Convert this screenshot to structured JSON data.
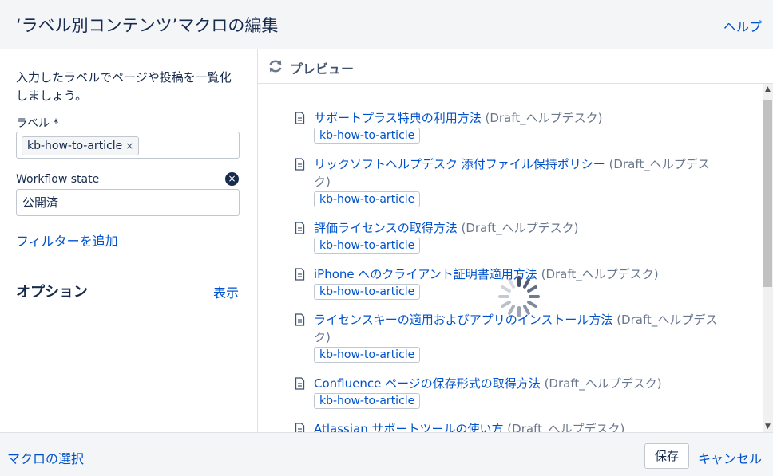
{
  "header": {
    "title": "‘ラベル別コンテンツ’マクロの編集",
    "help": "ヘルプ"
  },
  "left": {
    "description": "入力したラベルでページや投稿を一覧化しましょう。",
    "label_field": {
      "label": "ラベル *",
      "chip": "kb-how-to-article",
      "chip_remove": "×"
    },
    "workflow": {
      "label": "Workflow state",
      "clear": "×",
      "value": "公開済"
    },
    "add_filter": "フィルターを追加",
    "options": {
      "heading": "オプション",
      "show": "表示"
    }
  },
  "preview": {
    "title": "プレビュー",
    "items": [
      {
        "title": "サポートプラス特典の利用方法",
        "space": "(Draft_ヘルプデスク)",
        "tag": "kb-how-to-article"
      },
      {
        "title": "リックソフトヘルプデスク 添付ファイル保持ポリシー",
        "space": "(Draft_ヘルプデスク)",
        "tag": "kb-how-to-article"
      },
      {
        "title": "評価ライセンスの取得方法",
        "space": "(Draft_ヘルプデスク)",
        "tag": "kb-how-to-article"
      },
      {
        "title": "iPhone へのクライアント証明書適用方法",
        "space": "(Draft_ヘルプデスク)",
        "tag": "kb-how-to-article"
      },
      {
        "title": "ライセンスキーの適用およびアプリのインストール方法",
        "space": "(Draft_ヘルプデスク)",
        "tag": "kb-how-to-article"
      },
      {
        "title": "Confluence ページの保存形式の取得方法",
        "space": "(Draft_ヘルプデスク)",
        "tag": "kb-how-to-article"
      },
      {
        "title": "Atlassian サポートツールの使い方",
        "space": "(Draft_ヘルプデスク)",
        "tag": ""
      }
    ]
  },
  "footer": {
    "select_macro": "マクロの選択",
    "save": "保存",
    "cancel": "キャンセル"
  },
  "colors": {
    "link": "#0052cc",
    "text": "#172b4d",
    "muted": "#6b778c",
    "panel_bg": "#f4f5f7"
  }
}
